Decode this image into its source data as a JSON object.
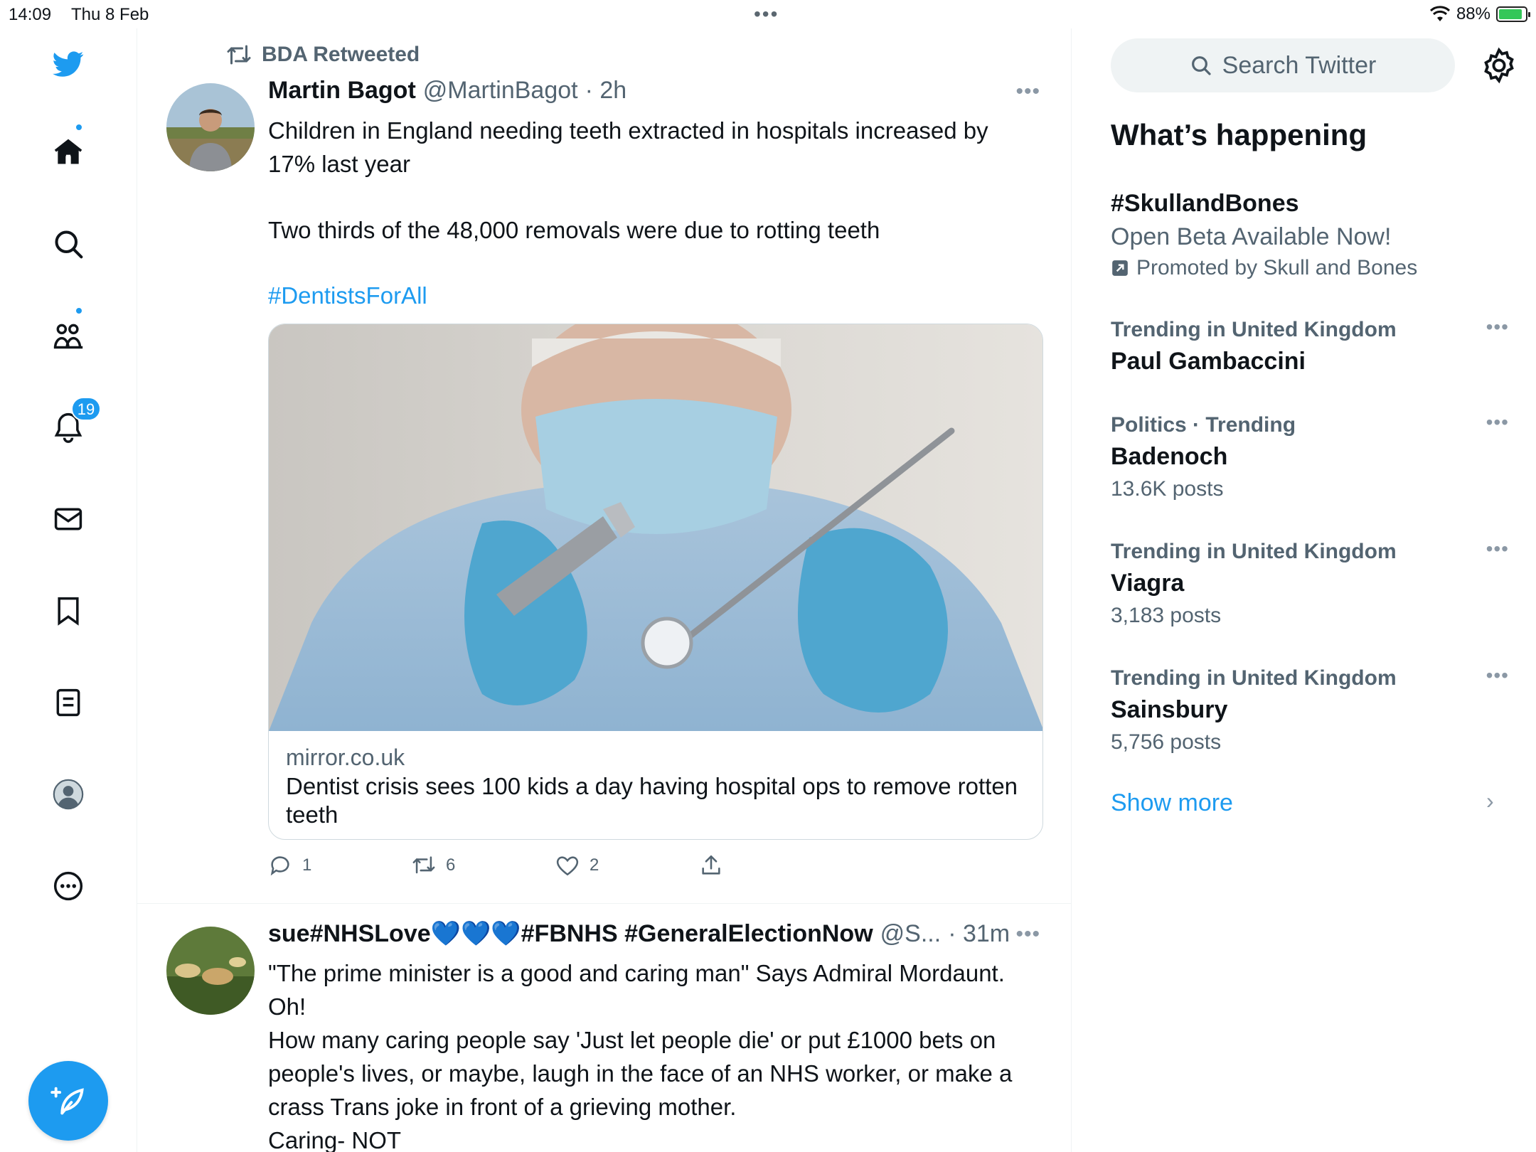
{
  "status_bar": {
    "time": "14:09",
    "date": "Thu 8 Feb",
    "battery": "88%",
    "battery_level": 0.88
  },
  "nav": {
    "notifications_badge": "19",
    "icons": [
      "twitter-logo-icon",
      "home-icon",
      "search-icon",
      "communities-icon",
      "notifications-icon",
      "messages-icon",
      "bookmarks-icon",
      "lists-icon",
      "profile-icon",
      "more-icon",
      "compose-icon"
    ]
  },
  "tweet1": {
    "retweeted_by": "BDA Retweeted",
    "name": "Martin Bagot",
    "handle": "@MartinBagot",
    "time": "· 2h",
    "text_line1": "Children in England needing teeth extracted in hospitals increased by 17% last year",
    "text_line2": "Two thirds of the 48,000 removals were due to rotting teeth",
    "hashtag": "#DentistsForAll",
    "card": {
      "domain": "mirror.co.uk",
      "title": "Dentist crisis sees 100 kids a day having hospital ops to remove rotten teeth"
    },
    "actions": {
      "replies": "1",
      "retweets": "6",
      "likes": "2"
    }
  },
  "tweet2": {
    "name": "sue#NHSLove💙💙💙#FBNHS #GeneralElectionNow",
    "handle": "@S...",
    "time": "· 31m",
    "line1": "\"The prime minister is a good and caring man\" Says Admiral Mordaunt.",
    "line2": "Oh!",
    "line3": "How many caring people say 'Just let people die' or put £1000 bets on people's lives, or maybe, laugh in the face of an NHS worker, or make a crass Trans joke in front of a grieving mother.",
    "line4": "Caring- NOT"
  },
  "sidebar": {
    "search_placeholder": "Search Twitter",
    "title": "What’s happening",
    "promoted": {
      "name": "#SkullandBones",
      "tagline": "Open Beta Available Now!",
      "promoted_by": "Promoted by Skull and Bones"
    },
    "trends": [
      {
        "context": "Trending in United Kingdom",
        "name": "Paul Gambaccini",
        "posts": ""
      },
      {
        "context": "Politics · Trending",
        "name": "Badenoch",
        "posts": "13.6K posts"
      },
      {
        "context": "Trending in United Kingdom",
        "name": "Viagra",
        "posts": "3,183 posts"
      },
      {
        "context": "Trending in United Kingdom",
        "name": "Sainsbury",
        "posts": "5,756 posts"
      }
    ],
    "show_more": "Show more"
  }
}
